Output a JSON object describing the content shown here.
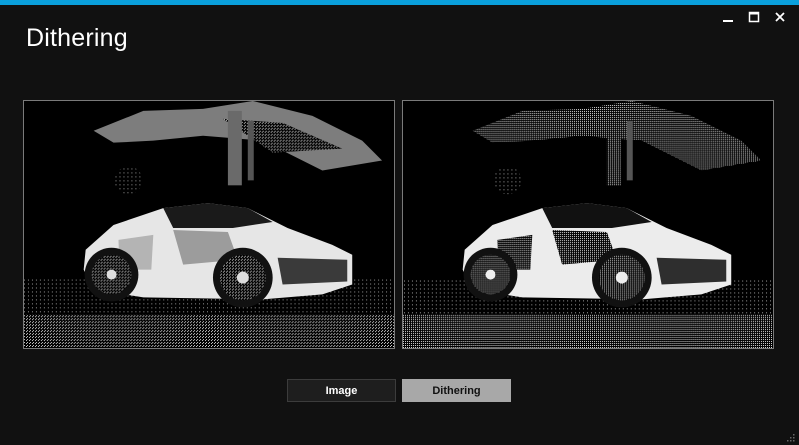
{
  "window": {
    "title": "Dithering",
    "accent_color": "#0aa0dc",
    "controls": [
      "minimize-icon",
      "maximize-icon",
      "close-icon"
    ]
  },
  "panels": [
    {
      "name": "original-image-panel",
      "content": "car image (black & white)"
    },
    {
      "name": "dithered-image-panel",
      "content": "car image (dithered)"
    }
  ],
  "buttons": {
    "image_label": "Image",
    "dithering_label": "Dithering",
    "active": "Dithering"
  }
}
